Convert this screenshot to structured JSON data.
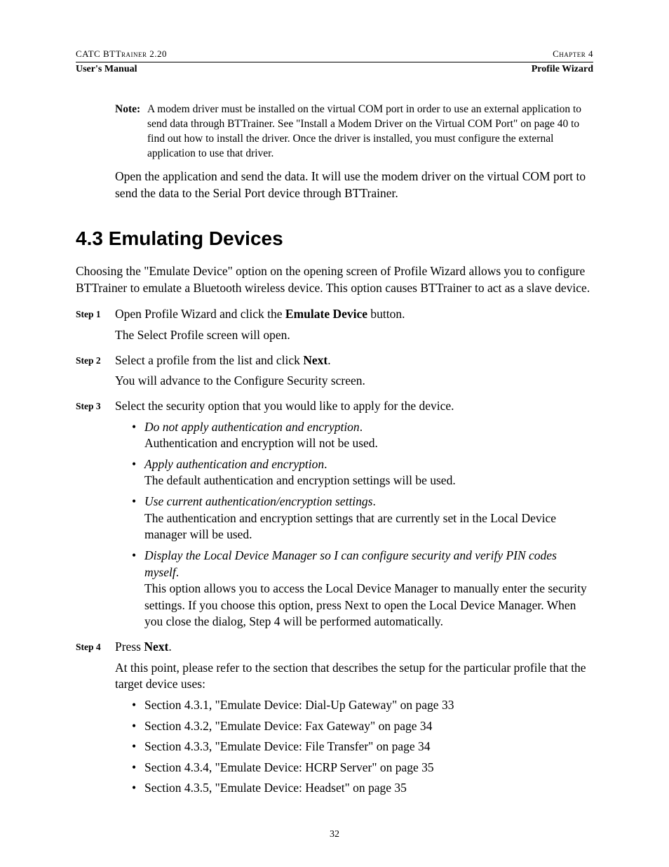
{
  "header": {
    "left": "CATC BTTrainer 2.20",
    "right": "Chapter 4",
    "sub_left": "User's Manual",
    "sub_right": "Profile Wizard"
  },
  "note": {
    "label": "Note:",
    "text": "A modem driver must be installed on the virtual COM port in order to use an external application to send data through BTTrainer. See \"Install a Modem Driver on the Virtual COM Port\" on page 40 to find out how to install the driver. Once the driver is installed, you must configure the external application to use that driver."
  },
  "open_para": "Open the application and send the data. It will use the modem driver on the virtual COM port to send the data to the Serial Port device through BTTrainer.",
  "section_title": "4.3  Emulating Devices",
  "intro": "Choosing the \"Emulate Device\" option on the opening screen of Profile Wizard allows you to configure BTTrainer to emulate a Bluetooth wireless device. This option causes BTTrainer to act as a slave device.",
  "steps": {
    "s1": {
      "label": "Step 1",
      "l1a": "Open Profile Wizard and click the ",
      "l1b": "Emulate Device",
      "l1c": " button.",
      "l2": "The Select Profile screen will open."
    },
    "s2": {
      "label": "Step 2",
      "l1a": "Select a profile from the list and click ",
      "l1b": "Next",
      "l1c": ".",
      "l2": "You will advance to the Configure Security screen."
    },
    "s3": {
      "label": "Step 3",
      "l1": "Select the security option that you would like to apply for the device.",
      "opts": [
        {
          "t": "Do not apply authentication and encryption",
          "d": "Authentication and encryption will not be used."
        },
        {
          "t": "Apply authentication and encryption",
          "d": "The default authentication and encryption settings will be used."
        },
        {
          "t": "Use current authentication/encryption settings",
          "d": "The authentication and encryption settings that are currently set in the Local Device manager will be used."
        },
        {
          "t": "Display the Local Device Manager so I can configure security and verify PIN codes myself",
          "d": "This option allows you to access the Local Device Manager to manually enter the security settings. If you choose this option, press Next to open the Local Device Manager. When you close the dialog, Step 4 will be performed automatically."
        }
      ]
    },
    "s4": {
      "label": "Step 4",
      "l1a": "Press ",
      "l1b": "Next",
      "l1c": ".",
      "l2": "At this point, please refer to the section that describes the setup for the particular profile that the target device uses:",
      "refs": [
        "Section 4.3.1, \"Emulate Device: Dial-Up Gateway\" on page 33",
        "Section 4.3.2, \"Emulate Device: Fax Gateway\" on page 34",
        "Section 4.3.3, \"Emulate Device: File Transfer\" on page 34",
        "Section 4.3.4, \"Emulate Device: HCRP Server\" on page 35",
        "Section 4.3.5, \"Emulate Device: Headset\" on page 35"
      ]
    }
  },
  "page_number": "32"
}
